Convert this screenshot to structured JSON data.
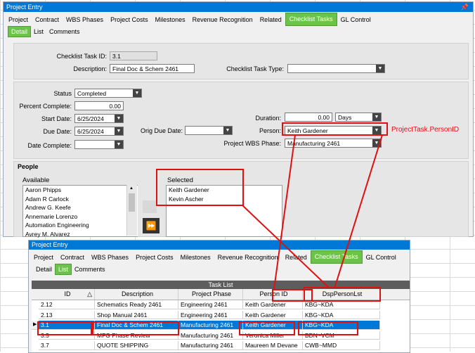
{
  "window1": {
    "title": "Project Entry",
    "pin_icon": "pin-icon",
    "tabs": [
      "Project",
      "Contract",
      "WBS Phases",
      "Project Costs",
      "Milestones",
      "Revenue Recognition",
      "Related",
      "Checklist Tasks",
      "GL Control"
    ],
    "active_tab": "Checklist Tasks",
    "subtabs": [
      "Detail",
      "List",
      "Comments"
    ],
    "active_subtab": "Detail",
    "task_id_label": "Checklist Task ID:",
    "task_id_value": "3.1",
    "description_label": "Description:",
    "description_value": "Final Doc & Schem 2461",
    "task_type_label": "Checklist Task Type:",
    "task_type_value": "",
    "status_label": "Status",
    "status_value": "Completed",
    "percent_label": "Percent Complete:",
    "percent_value": "0.00",
    "start_date_label": "Start Date:",
    "start_date_value": "6/25/2024",
    "due_date_label": "Due Date:",
    "due_date_value": "6/25/2024",
    "orig_due_label": "Orig Due Date:",
    "orig_due_value": "",
    "date_complete_label": "Date Complete:",
    "date_complete_value": "",
    "duration_label": "Duration:",
    "duration_value": "0.00",
    "duration_unit": "Days",
    "person_label": "Person:",
    "person_value": "Keith Gardener",
    "wbs_label": "Project WBS Phase:",
    "wbs_value": "Manufacturing 2461",
    "people_label": "People",
    "available_label": "Available",
    "available_items": [
      "Aaron Phipps",
      "Adam R Carlock",
      "Andrew G. Keefe",
      "Annemarie Lorenzo",
      "Automation Engineering",
      "Avrey M. Alvarez"
    ],
    "selected_label": "Selected",
    "selected_items": [
      "Keith Gardener",
      "Kevin Ascher"
    ]
  },
  "annotation": {
    "person_id_field": "ProjectTask.PersonID",
    "color": "#e01010"
  },
  "window2": {
    "title": "Project Entry",
    "tabs": [
      "Project",
      "Contract",
      "WBS Phases",
      "Project Costs",
      "Milestones",
      "Revenue Recognition",
      "Related",
      "Checklist Tasks",
      "GL Control"
    ],
    "active_tab": "Checklist Tasks",
    "subtabs": [
      "Detail",
      "List",
      "Comments"
    ],
    "active_subtab": "List",
    "table_title": "Task List",
    "columns": [
      "ID",
      "Description",
      "Project Phase",
      "Person ID",
      "DspPersonLst"
    ],
    "rows": [
      [
        "2.12",
        "Schematics Ready 2461",
        "Engineering 2461",
        "Keith Gardener",
        "KBG~KDA"
      ],
      [
        "2.13",
        "Shop Manual 2461",
        "Engineering 2461",
        "Keith Gardener",
        "KBG~KDA"
      ],
      [
        "3.1",
        "Final Doc & Schem 2461",
        "Manufacturing 2461",
        "Keith Gardener",
        "KBG~KDA"
      ],
      [
        "3.5",
        "MFG Phase Review",
        "Manufacturing 2461",
        "Veronica Miller",
        "BDN~VCM"
      ],
      [
        "3.7",
        "QUOTE SHIPPING",
        "Manufacturing 2461",
        "Maureen M Devane",
        "CWB~MMD"
      ]
    ],
    "selected_row_index": 2,
    "sort_icon": "sort-ascending-icon"
  },
  "colors": {
    "title_bar": "#0078d7",
    "active_tab": "#6cc24a",
    "selection": "#0078d7",
    "table_header": "#5d5d5d"
  }
}
